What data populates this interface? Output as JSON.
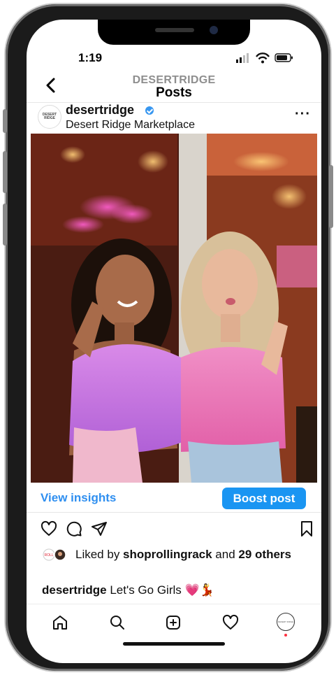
{
  "status_bar": {
    "time": "1:19"
  },
  "header": {
    "account": "DESERTRIDGE",
    "title": "Posts"
  },
  "post": {
    "avatar_text": "DESERT RIDGE",
    "username": "desertridge",
    "location": "Desert Ridge Marketplace",
    "more_label": "···",
    "photo_description_icon": "photo-two-women-pink-feather-tops",
    "insights_label": "View insights",
    "boost_label": "Boost post",
    "liked_by_prefix": "Liked by ",
    "liked_by_user": "shoprollingrack",
    "liked_by_and": " and ",
    "liked_by_others": "29 others",
    "caption_user": "desertridge",
    "caption_text": " Let's Go Girls 💗💃"
  },
  "colors": {
    "accent": "#1a95f2",
    "link": "#2f8ff0",
    "notification": "#ff3040"
  }
}
